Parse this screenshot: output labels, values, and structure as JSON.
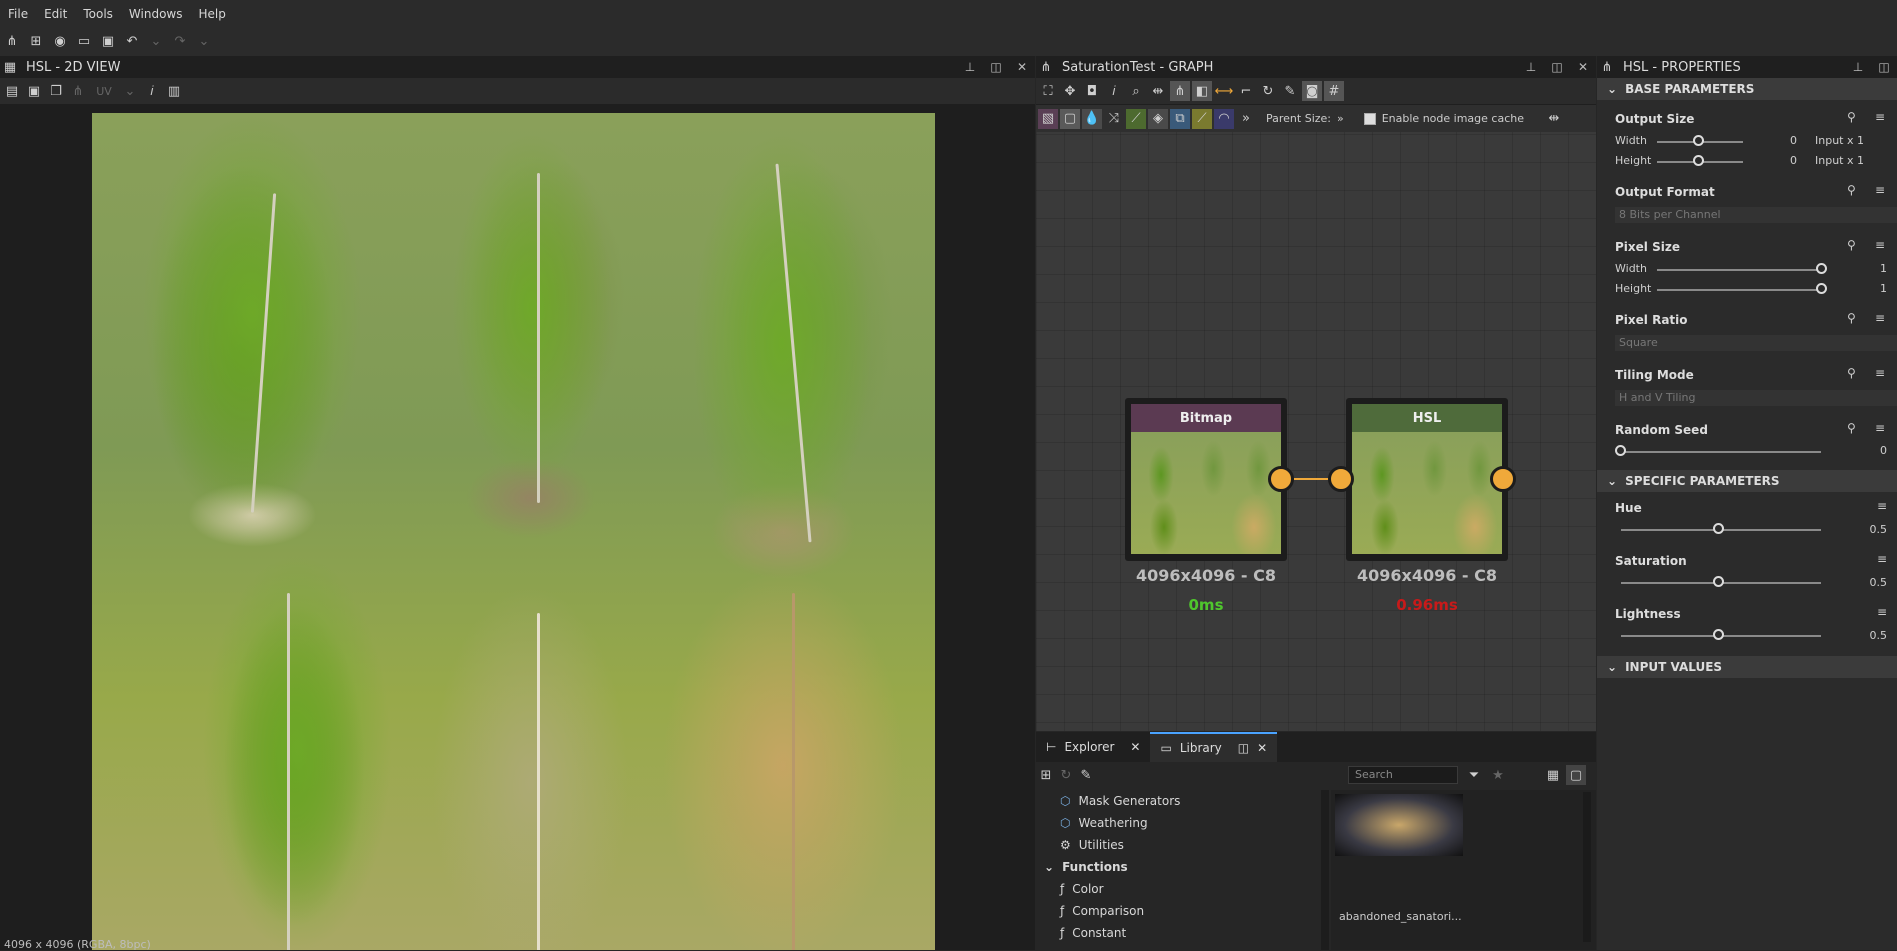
{
  "menu": [
    "File",
    "Edit",
    "Tools",
    "Windows",
    "Help"
  ],
  "view2d": {
    "title": "HSL - 2D VIEW",
    "uv_label": "UV",
    "status": "4096 x 4096 (RGBA, 8bpc)"
  },
  "graph": {
    "title": "SaturationTest - GRAPH",
    "parent_size_label": "Parent Size:",
    "parent_size_value": "»",
    "cache_label": "Enable node image cache",
    "nodes": [
      {
        "name": "Bitmap",
        "size": "4096x4096 - C8",
        "time": "0ms",
        "head_color": "#5b3a52",
        "time_color": "#4fc72d"
      },
      {
        "name": "HSL",
        "size": "4096x4096 - C8",
        "time": "0.96ms",
        "head_color": "#4f6b3b",
        "time_color": "#c81a1a"
      }
    ]
  },
  "library": {
    "tabs": [
      "Explorer",
      "Library"
    ],
    "search_placeholder": "Search",
    "items": [
      {
        "label": "Mask Generators",
        "type": "sub"
      },
      {
        "label": "Weathering",
        "type": "sub"
      },
      {
        "label": "Utilities",
        "type": "sub"
      },
      {
        "label": "Functions",
        "type": "head"
      },
      {
        "label": "Color",
        "type": "fn"
      },
      {
        "label": "Comparison",
        "type": "fn"
      },
      {
        "label": "Constant",
        "type": "fn"
      }
    ],
    "thumb_label": "abandoned_sanatori..."
  },
  "properties": {
    "title": "HSL - PROPERTIES",
    "sections": {
      "base": "BASE PARAMETERS",
      "specific": "SPECIFIC PARAMETERS",
      "inputs": "INPUT VALUES"
    },
    "output_size": {
      "label": "Output Size",
      "width_label": "Width",
      "height_label": "Height",
      "width_value": "0",
      "height_value": "0",
      "width_mode": "Input x 1",
      "height_mode": "Input x 1"
    },
    "output_format": {
      "label": "Output Format",
      "value": "8 Bits per Channel"
    },
    "pixel_size": {
      "label": "Pixel Size",
      "width_label": "Width",
      "height_label": "Height",
      "width_value": "1",
      "height_value": "1"
    },
    "pixel_ratio": {
      "label": "Pixel Ratio",
      "value": "Square"
    },
    "tiling_mode": {
      "label": "Tiling Mode",
      "value": "H and V Tiling"
    },
    "random_seed": {
      "label": "Random Seed",
      "value": "0"
    },
    "hue": {
      "label": "Hue",
      "value": "0.5"
    },
    "saturation": {
      "label": "Saturation",
      "value": "0.5"
    },
    "lightness": {
      "label": "Lightness",
      "value": "0.5"
    }
  }
}
